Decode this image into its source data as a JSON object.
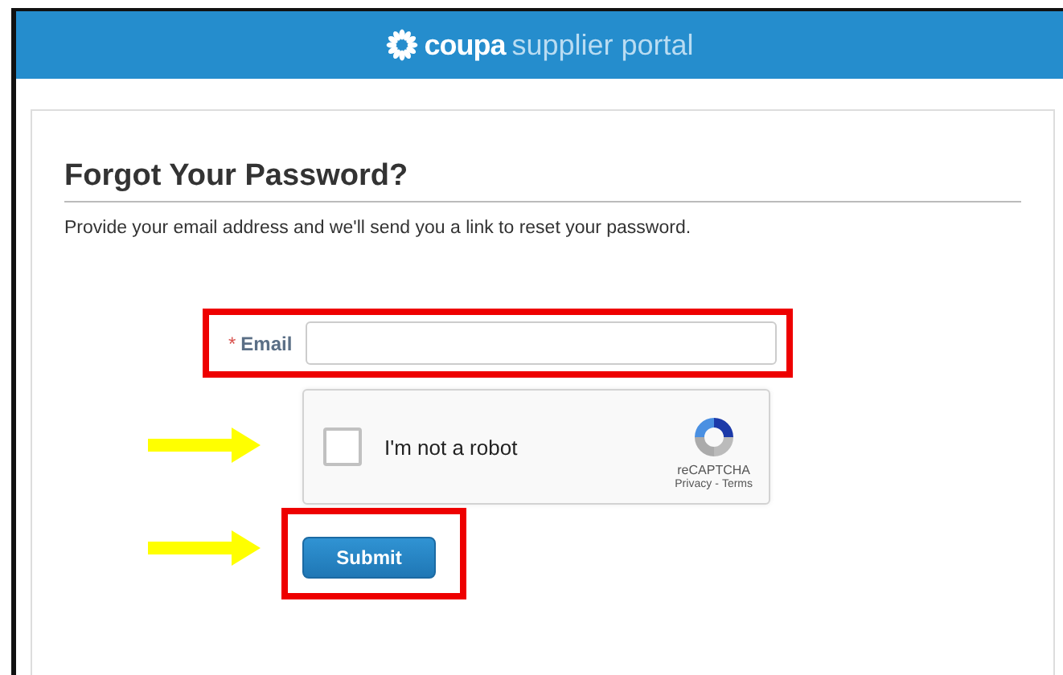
{
  "header": {
    "brand": "coupa",
    "product": "supplier portal"
  },
  "form": {
    "title": "Forgot Your Password?",
    "description": "Provide your email address and we'll send you a link to reset your password.",
    "email": {
      "required_mark": "*",
      "label": "Email",
      "highlighted": true
    },
    "captcha": {
      "label": "I'm not a robot",
      "checked": false,
      "brand": "reCAPTCHA",
      "privacy": "Privacy",
      "separator": "-",
      "terms": "Terms",
      "pointed": true
    },
    "submit": {
      "label": "Submit",
      "highlighted": true,
      "pointed": true
    }
  }
}
